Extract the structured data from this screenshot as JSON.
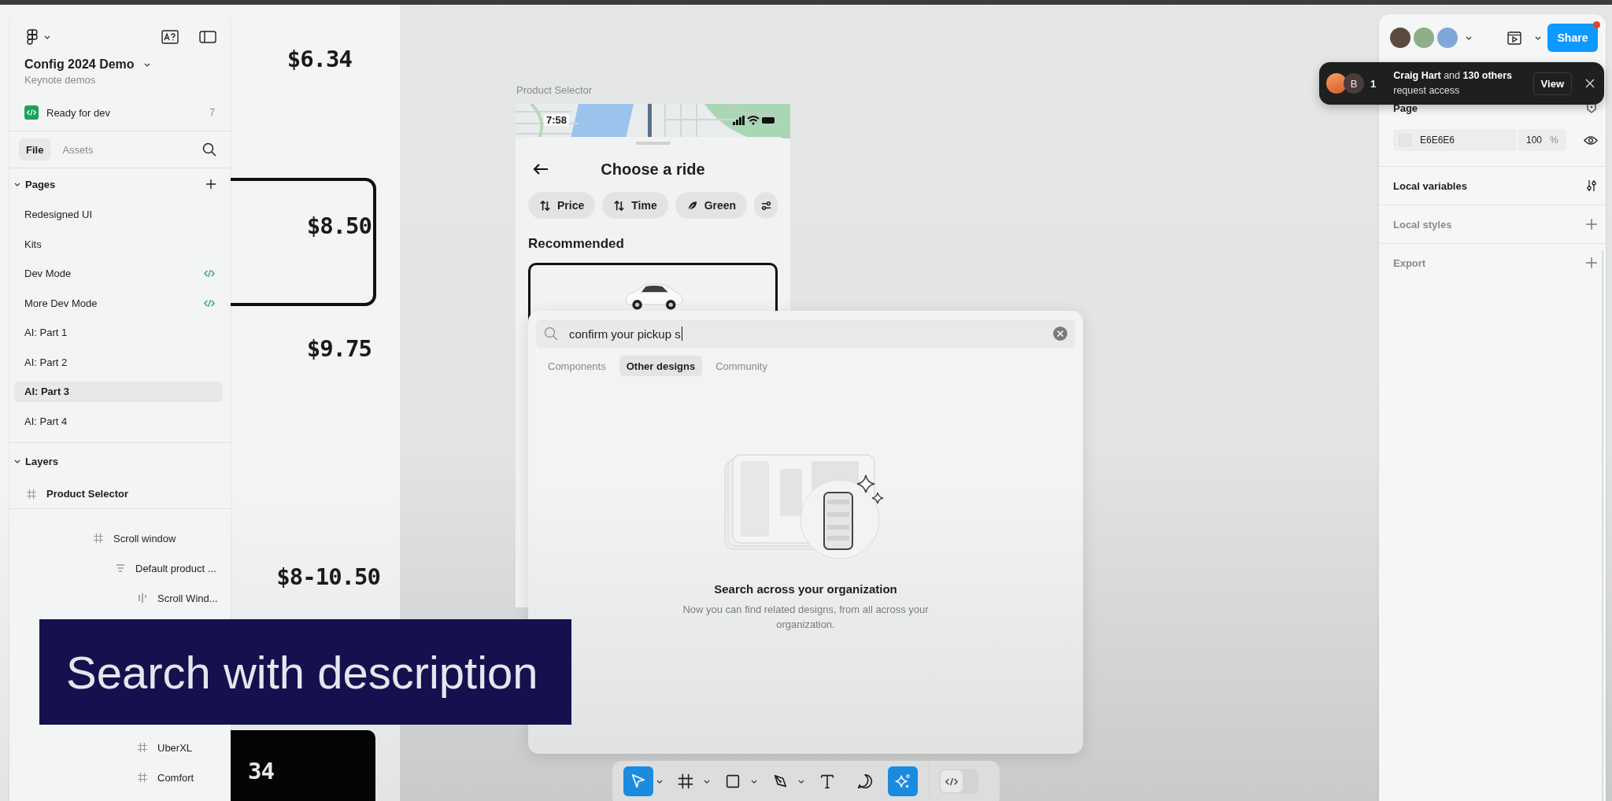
{
  "file": {
    "title": "Config 2024 Demo",
    "project": "Keynote demos",
    "ready_for_dev": {
      "label": "Ready for dev",
      "count": "7"
    }
  },
  "left_tabs": [
    {
      "label": "File",
      "selected": true
    },
    {
      "label": "Assets",
      "selected": false
    }
  ],
  "pages": {
    "title": "Pages",
    "expanded": true,
    "items": [
      {
        "label": "Redesigned UI",
        "dev": false,
        "selected": false
      },
      {
        "label": "Kits",
        "dev": false,
        "selected": false
      },
      {
        "label": "Dev Mode",
        "dev": true,
        "selected": false
      },
      {
        "label": "More Dev Mode",
        "dev": true,
        "selected": false
      },
      {
        "label": "AI: Part 1",
        "dev": false,
        "selected": false
      },
      {
        "label": "AI: Part 2",
        "dev": false,
        "selected": false
      },
      {
        "label": "AI: Part 3",
        "dev": false,
        "selected": true
      },
      {
        "label": "AI: Part 4",
        "dev": false,
        "selected": false
      }
    ]
  },
  "layers": {
    "title": "Layers",
    "expanded": true,
    "items": [
      {
        "name": "Product Selector",
        "kind": "frame",
        "children": [
          {
            "name": "Scroll window",
            "kind": "frame",
            "children": [
              {
                "name": "Default product ...",
                "kind": "stack",
                "children": [
                  {
                    "name": "Scroll Wind...",
                    "kind": "row"
                  },
                  {
                    "name": "UberXL",
                    "kind": "frame"
                  },
                  {
                    "name": "Comfort",
                    "kind": "frame"
                  }
                ]
              }
            ]
          }
        ]
      }
    ]
  },
  "canvas": {
    "prices": [
      {
        "text": "$6.34",
        "kind": "plain"
      },
      {
        "text": "$8.50",
        "kind": "outlined"
      },
      {
        "text": "$9.75",
        "kind": "plain"
      },
      {
        "text": "$8-10.50",
        "kind": "plain"
      },
      {
        "text": "34",
        "kind": "dark"
      }
    ],
    "frame_label": "Product Selector"
  },
  "phone": {
    "time": "7:58",
    "title": "Choose a ride",
    "chips": [
      {
        "label": "Price",
        "kind": "sort"
      },
      {
        "label": "Time",
        "kind": "sort"
      },
      {
        "label": "Green",
        "kind": "leaf"
      },
      {
        "kind": "filter"
      }
    ],
    "section": "Recommended"
  },
  "search": {
    "value": "confirm your pickup s",
    "tabs": [
      {
        "label": "Components",
        "selected": false
      },
      {
        "label": "Other designs",
        "selected": true
      },
      {
        "label": "Community",
        "selected": false
      }
    ],
    "empty_title": "Search across your organization",
    "empty_text": "Now you can find related designs, from all across your organization."
  },
  "toolbar": {
    "tools": [
      {
        "kind": "move",
        "selected": true,
        "menu": true
      },
      {
        "kind": "frame",
        "selected": false,
        "menu": true
      },
      {
        "kind": "rectangle",
        "selected": false,
        "menu": true
      },
      {
        "kind": "pen",
        "selected": false,
        "menu": true
      },
      {
        "kind": "text",
        "selected": false,
        "menu": false
      },
      {
        "kind": "comment",
        "selected": false,
        "menu": false
      },
      {
        "kind": "ai",
        "selected": true,
        "menu": false
      }
    ],
    "dev_mode": {
      "on": false
    }
  },
  "collaborators": [
    {
      "color": "#5b4a3e"
    },
    {
      "color": "#8fae8a"
    },
    {
      "color": "#7fa8d8"
    }
  ],
  "share": {
    "label": "Share",
    "notification": true
  },
  "toast": {
    "initial": "B",
    "count": "1",
    "message": "**Craig Hart** and **130 others** request access",
    "action": "View"
  },
  "properties": {
    "page": {
      "title": "Page",
      "color": "E6E6E6",
      "opacity": "100",
      "unit": "%"
    },
    "sections": [
      {
        "label": "Local variables",
        "kind": "variables",
        "empty": false
      },
      {
        "label": "Local styles",
        "kind": "add",
        "empty": true
      },
      {
        "label": "Export",
        "kind": "add",
        "empty": true
      }
    ]
  },
  "caption": "Search with description"
}
